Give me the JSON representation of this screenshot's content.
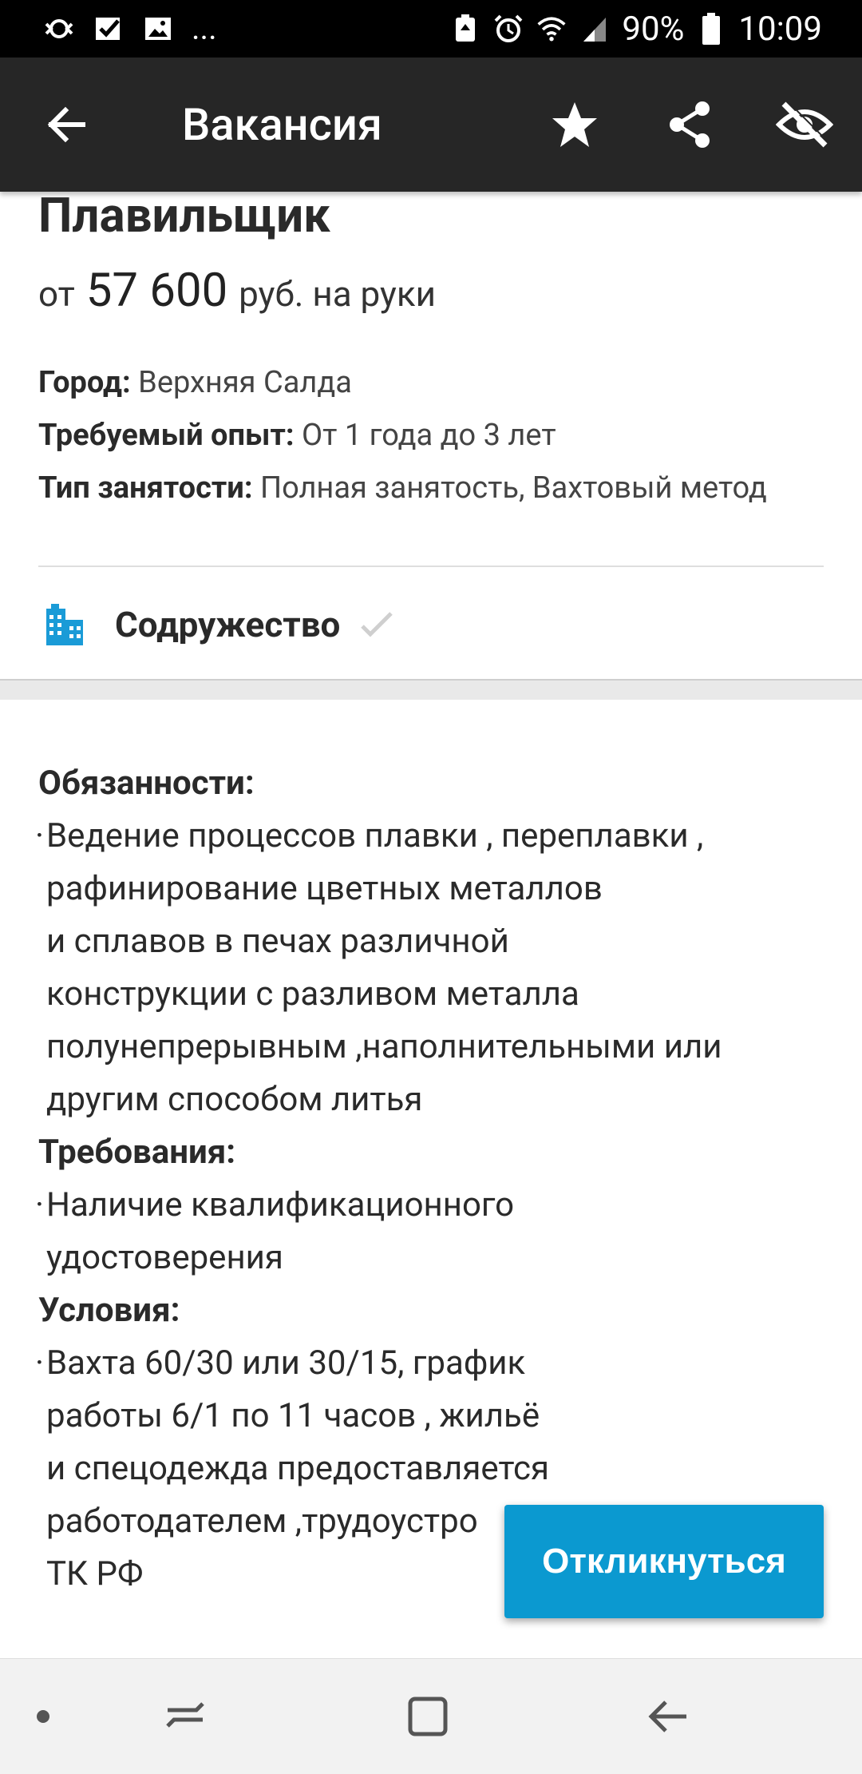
{
  "status_bar": {
    "battery_percent": "90%",
    "time": "10:09",
    "left_icons": [
      "sync-icon",
      "check-icon",
      "image-icon",
      "more-notifications-icon"
    ],
    "right_icons": [
      "battery-saver-icon",
      "alarm-icon",
      "wifi-icon",
      "signal-icon",
      "battery-icon"
    ],
    "more_label": "..."
  },
  "appbar": {
    "title": "Вакансия",
    "actions": [
      "star-icon",
      "share-icon",
      "hide-icon"
    ]
  },
  "job": {
    "title": "Плавильщик",
    "salary_prefix": "от",
    "salary_value": "57 600",
    "salary_suffix": "руб. на руки",
    "city_label": "Город:",
    "city_value": "Верхняя Салда",
    "experience_label": "Требуемый опыт:",
    "experience_value": "От 1 года до 3 лет",
    "employment_label": "Тип занятости:",
    "employment_value": "Полная занятость, Вахтовый метод"
  },
  "company": {
    "name": "Содружество"
  },
  "description": {
    "duties_title": "Обязанности:",
    "duties_lines": [
      "Ведение процессов плавки , переплавки ,",
      "рафинирование цветных металлов",
      "и сплавов в печах различной",
      "конструкции с разливом металла",
      "полунепрерывным ,наполнительными или",
      "другим способом литья"
    ],
    "requirements_title": "Требования:",
    "requirements_lines": [
      "Наличие квалификационного",
      "удостоверения"
    ],
    "conditions_title": "Условия:",
    "conditions_lines": [
      "Вахта 60/30 или 30/15, график",
      "работы 6/1 по 11 часов , жильё",
      "и спецодежда предоставляется",
      "работодателем ,трудоустро",
      "ТК РФ"
    ],
    "bullet": "·"
  },
  "respond_button": "Откликнуться",
  "colors": {
    "appbar": "#262626",
    "accent": "#0b99d0",
    "company_icon": "#1a9bd7"
  }
}
